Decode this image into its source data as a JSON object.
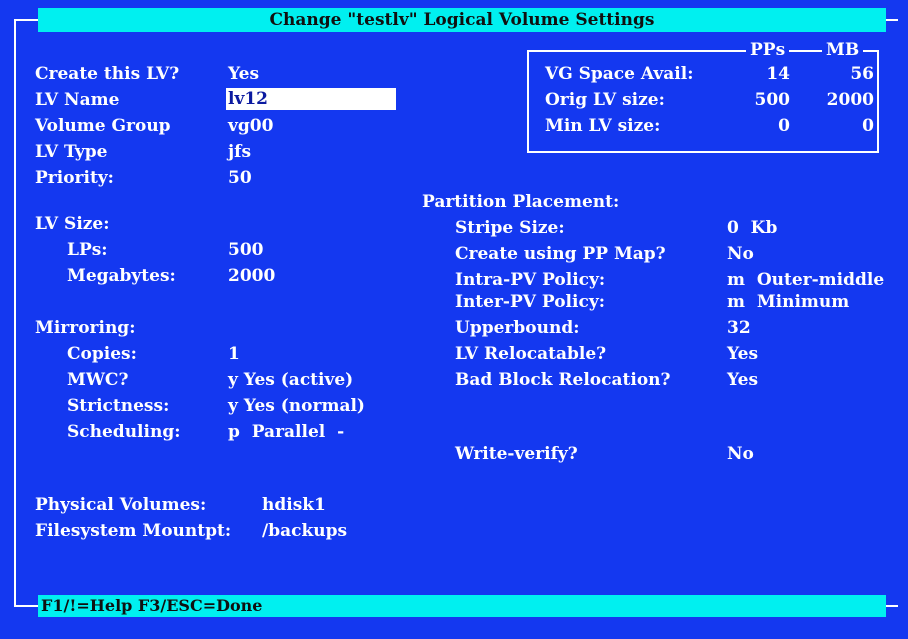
{
  "title": "Change \"testlv\" Logical Volume Settings",
  "left": {
    "create_label": "Create this LV?",
    "create_value": "Yes",
    "name_label": "LV Name",
    "name_value": "lv12",
    "vg_label": "Volume Group",
    "vg_value": "vg00",
    "type_label": "LV Type",
    "type_value": "jfs",
    "priority_label": "Priority:",
    "priority_value": "50",
    "size_label": "LV Size:",
    "lps_label": "LPs:",
    "lps_value": "500",
    "mb_label": "Megabytes:",
    "mb_value": "2000",
    "mirroring_label": "Mirroring:",
    "copies_label": "Copies:",
    "copies_value": "1",
    "mwc_label": "MWC?",
    "mwc_value": "y Yes (active)",
    "strictness_label": "Strictness:",
    "strictness_value": "y Yes (normal)",
    "scheduling_label": "Scheduling:",
    "scheduling_value": "p  Parallel  -",
    "pv_label": "Physical Volumes:",
    "pv_value": "hdisk1",
    "mount_label": "Filesystem Mountpt:",
    "mount_value": "/backups"
  },
  "vg_box": {
    "pps_header": "PPs",
    "mb_header": "MB",
    "rows": [
      {
        "label": "VG Space Avail:",
        "pps": "14",
        "mb": "56"
      },
      {
        "label": "Orig LV size:",
        "pps": "500",
        "mb": "2000"
      },
      {
        "label": "Min LV size:",
        "pps": "0",
        "mb": "0"
      }
    ]
  },
  "placement": {
    "heading": "Partition Placement:",
    "stripe_label": "Stripe Size:",
    "stripe_value": "0  Kb",
    "ppmap_label": "Create using PP Map?",
    "ppmap_value": "No",
    "intra_label": "Intra-PV Policy:",
    "intra_value": "m  Outer-middle",
    "inter_label": "Inter-PV Policy:",
    "inter_value": "m  Minimum",
    "upper_label": "Upperbound:",
    "upper_value": "32",
    "reloc_label": "LV Relocatable?",
    "reloc_value": "Yes",
    "badblock_label": "Bad Block Relocation?",
    "badblock_value": "Yes",
    "writeverify_label": "Write-verify?",
    "writeverify_value": "No"
  },
  "status": "F1/!=Help  F3/ESC=Done",
  "colors": {
    "background": "#1438f0",
    "bar": "#00f0f0",
    "text": "#ffffff"
  }
}
